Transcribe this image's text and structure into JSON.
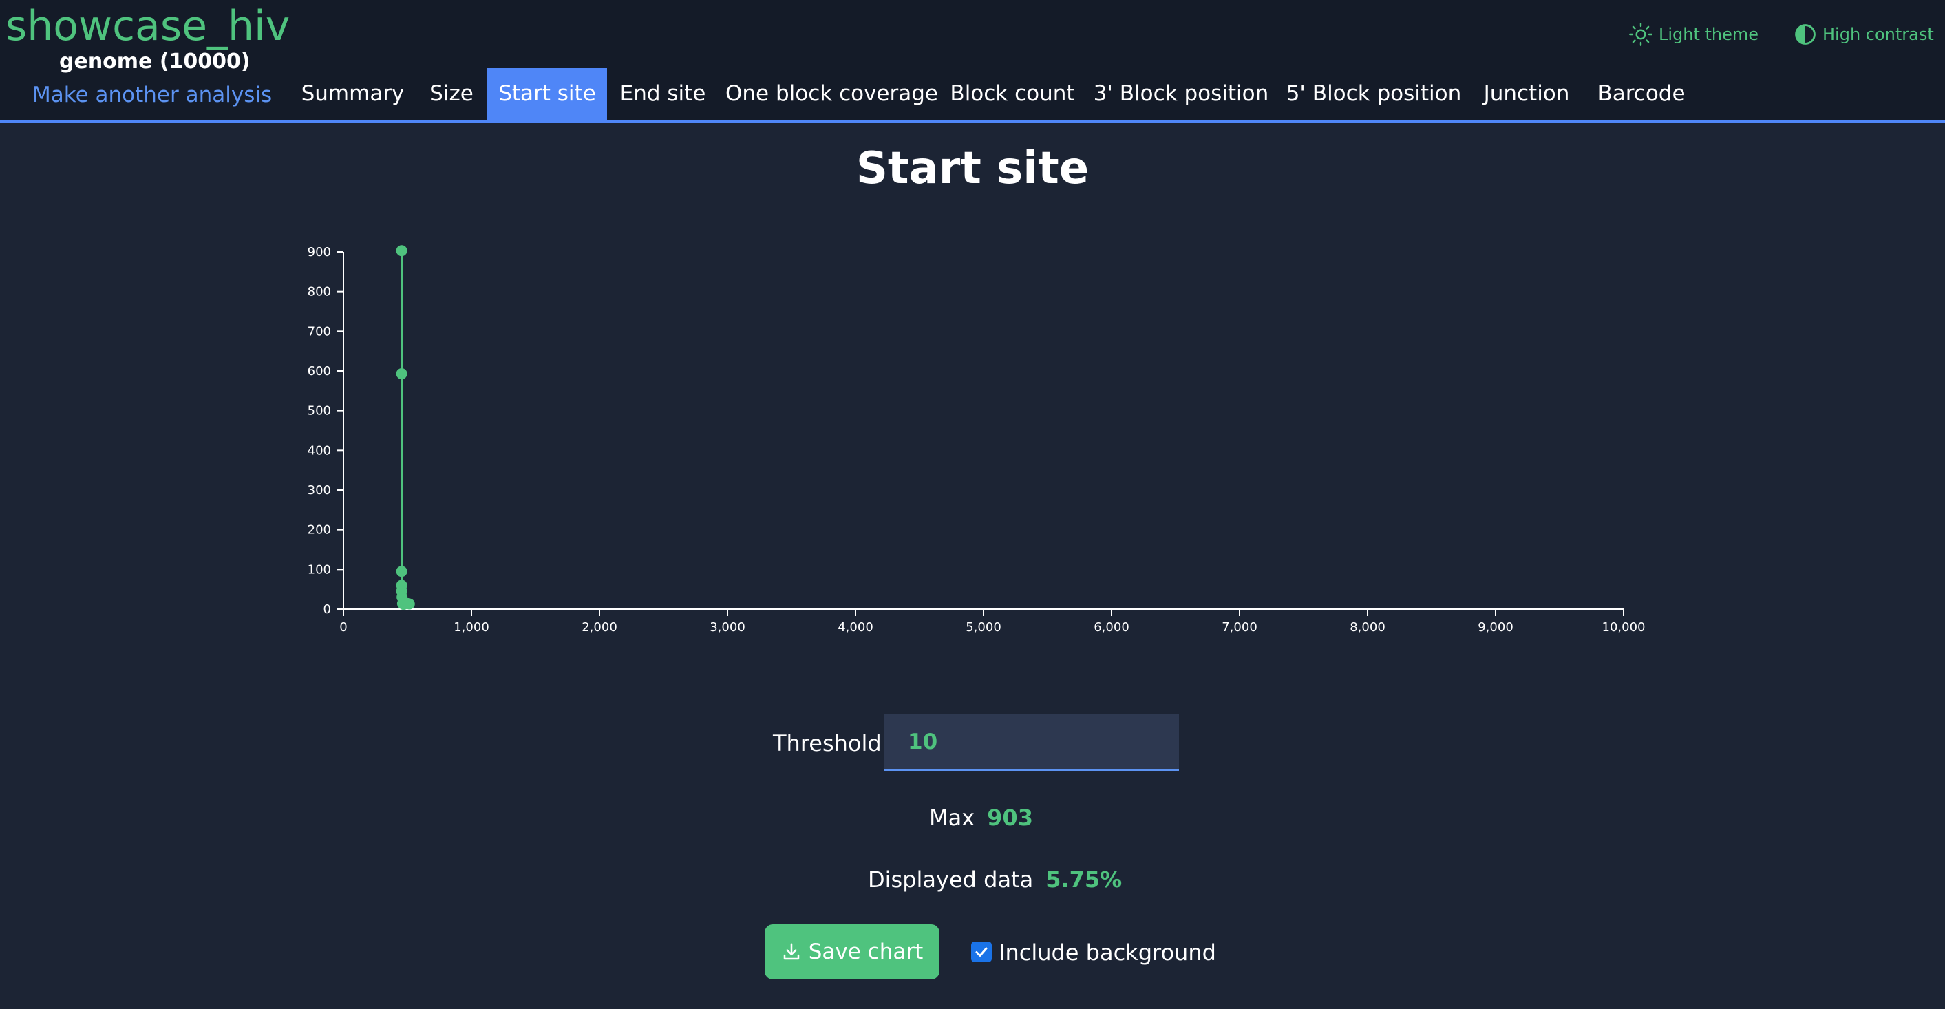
{
  "app": {
    "title": "showcase_hiv",
    "subtitle": "genome (10000)",
    "another_analysis_label": "Make another analysis"
  },
  "theme_controls": {
    "light_theme_label": "Light theme",
    "high_contrast_label": "High contrast"
  },
  "tabs": [
    {
      "label": "Summary",
      "active": false
    },
    {
      "label": "Size",
      "active": false
    },
    {
      "label": "Start site",
      "active": true
    },
    {
      "label": "End site",
      "active": false
    },
    {
      "label": "One block coverage",
      "active": false
    },
    {
      "label": "Block count",
      "active": false
    },
    {
      "label": "3' Block position",
      "active": false
    },
    {
      "label": "5' Block position",
      "active": false
    },
    {
      "label": "Junction",
      "active": false
    },
    {
      "label": "Barcode",
      "active": false
    }
  ],
  "page": {
    "heading": "Start site"
  },
  "chart_data": {
    "type": "scatter",
    "title": "",
    "xlabel": "",
    "ylabel": "",
    "xlim": [
      0,
      10000
    ],
    "ylim": [
      0,
      900
    ],
    "xticks": [
      "0",
      "1,000",
      "2,000",
      "3,000",
      "4,000",
      "5,000",
      "6,000",
      "7,000",
      "8,000",
      "9,000",
      "10,000"
    ],
    "yticks": [
      "0",
      "100",
      "200",
      "300",
      "400",
      "500",
      "600",
      "700",
      "800",
      "900"
    ],
    "grid": false,
    "legend": "none",
    "color": "#4fc37e",
    "points": [
      {
        "x": 455,
        "y": 903
      },
      {
        "x": 455,
        "y": 593
      },
      {
        "x": 455,
        "y": 95
      },
      {
        "x": 455,
        "y": 60
      },
      {
        "x": 455,
        "y": 45
      },
      {
        "x": 458,
        "y": 30
      },
      {
        "x": 462,
        "y": 14
      },
      {
        "x": 470,
        "y": 12
      },
      {
        "x": 500,
        "y": 14
      },
      {
        "x": 515,
        "y": 13
      }
    ]
  },
  "controls": {
    "threshold_label": "Threshold",
    "threshold_value": "10",
    "max_label": "Max",
    "max_value": "903",
    "displayed_label": "Displayed data",
    "displayed_value": "5.75%",
    "save_label": "Save chart",
    "include_background_label": "Include background",
    "include_background_checked": true
  },
  "colors": {
    "accent": "#4fc37e",
    "link": "#5c93f2",
    "active_tab": "#4f86f7",
    "background": "#1c2434",
    "header_background": "#141b28"
  }
}
